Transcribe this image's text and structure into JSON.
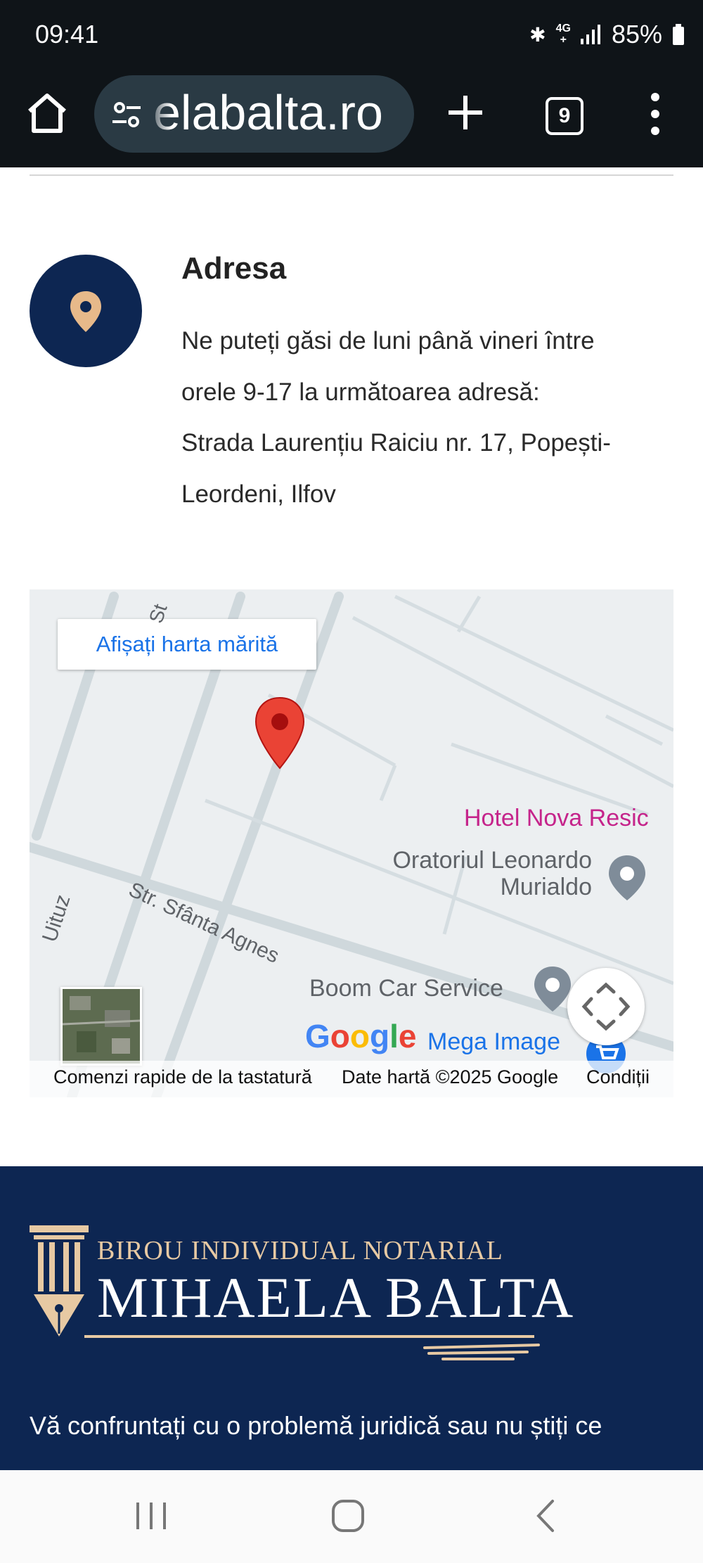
{
  "status_bar": {
    "time": "09:41",
    "battery": "85%",
    "network_top": "4G",
    "network_bottom": "+"
  },
  "browser": {
    "url": "elabalta.ro",
    "tab_count": "9"
  },
  "address_section": {
    "title": "Adresa",
    "lines": [
      "Ne puteți găsi de luni până vineri între",
      "orele 9-17 la următoarea adresă:",
      "Strada Laurențiu Raiciu nr. 17, Popești-",
      "Leordeni, Ilfov"
    ]
  },
  "map": {
    "view_larger_label": "Afișați harta mărită",
    "street_labels": [
      "Str. Sfânta Agnes",
      "Uituz",
      "St"
    ],
    "pois": {
      "hotel": "Hotel Nova Resic",
      "oratoriu_line1": "Oratoriul Leonardo",
      "oratoriu_line2": "Murialdo",
      "car_service": "Boom Car Service",
      "mega_image": "Mega Image"
    },
    "logo": [
      "G",
      "o",
      "o",
      "g",
      "l",
      "e"
    ],
    "footer": {
      "shortcuts": "Comenzi rapide de la tastatură",
      "map_data": "Date hartă ©2025 Google",
      "terms": "Condiții"
    },
    "colors": {
      "pin": "#ea4335",
      "hotel": "#c5248b",
      "link": "#1a73e8"
    }
  },
  "footer": {
    "brand_subtitle": "BIROU INDIVIDUAL NOTARIAL",
    "brand_name": "MIHAELA BALTA",
    "text": "Vă confruntați cu o problemă juridică sau nu știți ce"
  },
  "colors": {
    "navy": "#0d2652",
    "gold": "#e7c9a3"
  }
}
